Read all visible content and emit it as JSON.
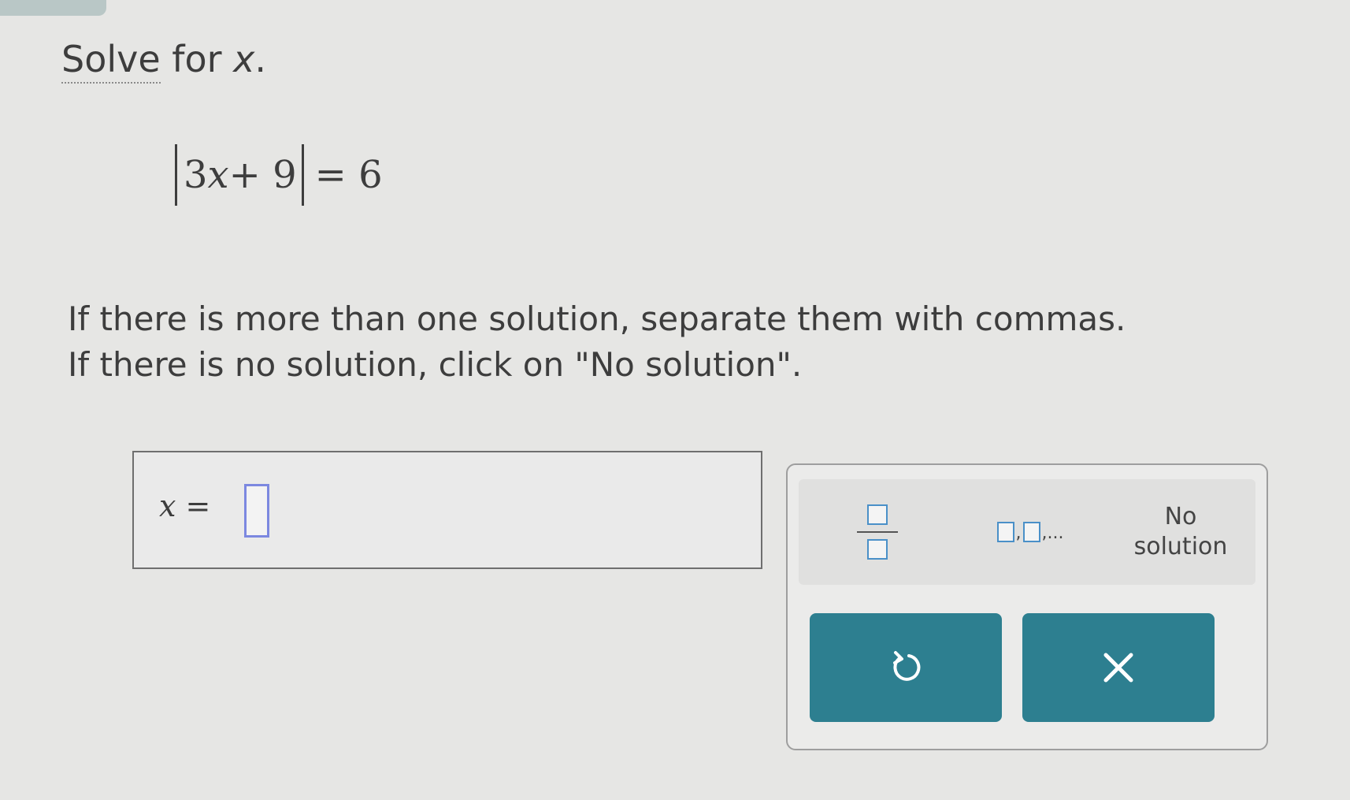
{
  "question": {
    "prompt_solve": "Solve",
    "prompt_rest": " for ",
    "prompt_var": "x",
    "prompt_end": "."
  },
  "equation": {
    "coef": "3",
    "var": "x",
    "rest": " + 9",
    "equals": "= 6"
  },
  "instructions": {
    "line1": "If there is more than one solution, separate them with commas.",
    "line2": "If there is no solution, click on \"No solution\"."
  },
  "answer": {
    "variable": "x",
    "equals": " =",
    "value": ""
  },
  "keypad": {
    "list_separator": ",",
    "list_ellipsis": ",...",
    "no_solution_line1": "No",
    "no_solution_line2": "solution",
    "undo_icon": "undo-icon",
    "clear_icon": "close-icon"
  },
  "colors": {
    "accent": "#2d7f90",
    "input_border": "#7c88e0",
    "key_box": "#4a90c8"
  }
}
